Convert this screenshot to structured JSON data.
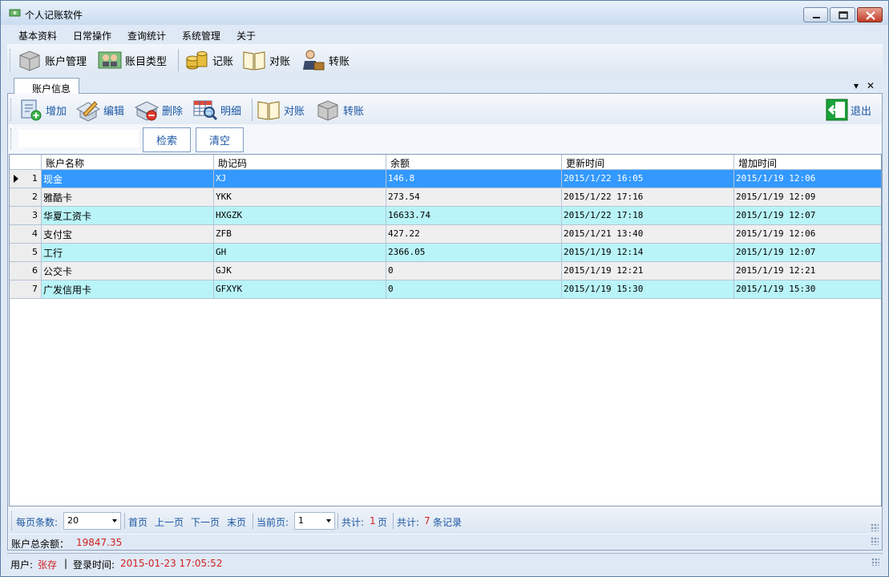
{
  "window": {
    "title": "个人记账软件"
  },
  "menu": [
    "基本资料",
    "日常操作",
    "查询统计",
    "系统管理",
    "关于"
  ],
  "toolbar1": {
    "account_mgmt": "账户管理",
    "category_type": "账目类型",
    "bookkeeping": "记账",
    "reconcile": "对账",
    "transfer": "转账"
  },
  "tab": {
    "label": "账户信息"
  },
  "toolbar2": {
    "add": "增加",
    "edit": "编辑",
    "delete": "删除",
    "detail": "明细",
    "reconcile": "对账",
    "transfer": "转账",
    "exit": "退出"
  },
  "search": {
    "value": "",
    "search_btn": "检索",
    "clear_btn": "清空"
  },
  "grid": {
    "headers": [
      "账户名称",
      "助记码",
      "余额",
      "更新时间",
      "增加时间"
    ],
    "rows": [
      {
        "n": "1",
        "name": "现金",
        "code": "XJ",
        "balance": "146.8",
        "updated": "2015/1/22 16:05",
        "added": "2015/1/19 12:06"
      },
      {
        "n": "2",
        "name": "雅酷卡",
        "code": "YKK",
        "balance": "273.54",
        "updated": "2015/1/22 17:16",
        "added": "2015/1/19 12:09"
      },
      {
        "n": "3",
        "name": "华夏工资卡",
        "code": "HXGZK",
        "balance": "16633.74",
        "updated": "2015/1/22 17:18",
        "added": "2015/1/19 12:07"
      },
      {
        "n": "4",
        "name": "支付宝",
        "code": "ZFB",
        "balance": "427.22",
        "updated": "2015/1/21 13:40",
        "added": "2015/1/19 12:06"
      },
      {
        "n": "5",
        "name": "工行",
        "code": "GH",
        "balance": "2366.05",
        "updated": "2015/1/19 12:14",
        "added": "2015/1/19 12:07"
      },
      {
        "n": "6",
        "name": "公交卡",
        "code": "GJK",
        "balance": "0",
        "updated": "2015/1/19 12:21",
        "added": "2015/1/19 12:21"
      },
      {
        "n": "7",
        "name": "广发信用卡",
        "code": "GFXYK",
        "balance": "0",
        "updated": "2015/1/19 15:30",
        "added": "2015/1/19 15:30"
      }
    ]
  },
  "pager": {
    "per_page_label": "每页条数:",
    "per_page_value": "20",
    "first": "首页",
    "prev": "上一页",
    "next": "下一页",
    "last": "末页",
    "current_label": "当前页:",
    "current_value": "1",
    "total_label": "共计:",
    "total_pages": "1",
    "pages_unit": "页",
    "total_label2": "共计:",
    "total_records": "7",
    "records_unit": "条记录"
  },
  "summary": {
    "label": "账户总余额：",
    "value": "19847.35"
  },
  "status": {
    "user_label": "用户:",
    "user_value": "张存",
    "separator": "|",
    "login_label": "登录时间:",
    "login_value": "2015-01-23 17:05:52"
  },
  "colors": {
    "selected_row": "#3399ff",
    "alt_row_cyan": "#b9f4f8",
    "alt_row_gray": "#efefef",
    "link_blue": "#1c57a3",
    "value_red": "#d32020"
  }
}
